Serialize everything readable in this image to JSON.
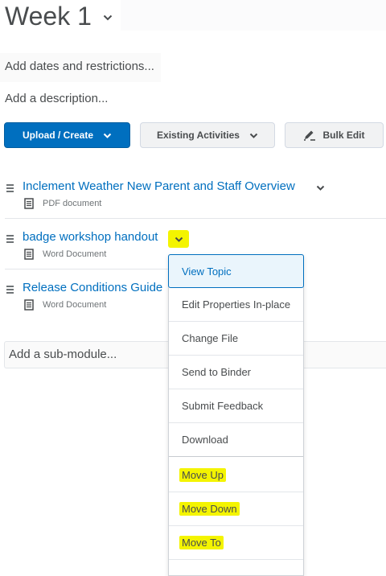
{
  "module": {
    "title": "Week 1",
    "add_dates": "Add dates and restrictions...",
    "add_description": "Add a description..."
  },
  "toolbar": {
    "upload_create": "Upload / Create",
    "existing_activities": "Existing Activities",
    "bulk_edit": "Bulk Edit"
  },
  "topics": [
    {
      "title": "Inclement Weather New Parent and Staff Overview",
      "type": "PDF document"
    },
    {
      "title": "badge workshop handout",
      "type": "Word Document"
    },
    {
      "title": "Release Conditions Guide",
      "type": "Word Document"
    }
  ],
  "sub_module": {
    "placeholder": "Add a sub-module..."
  },
  "context_menu": {
    "items": [
      {
        "label": "View Topic",
        "highlighted": false
      },
      {
        "label": "Edit Properties In-place",
        "highlighted": false
      },
      {
        "label": "Change File",
        "highlighted": false
      },
      {
        "label": "Send to Binder",
        "highlighted": false
      },
      {
        "label": "Submit Feedback",
        "highlighted": false
      },
      {
        "label": "Download",
        "highlighted": false
      },
      {
        "label": "Move Up",
        "highlighted": true
      },
      {
        "label": "Move Down",
        "highlighted": true
      },
      {
        "label": "Move To",
        "highlighted": true
      }
    ]
  },
  "colors": {
    "primary": "#006fbf",
    "highlight": "#f4f400",
    "text": "#494c4e"
  }
}
